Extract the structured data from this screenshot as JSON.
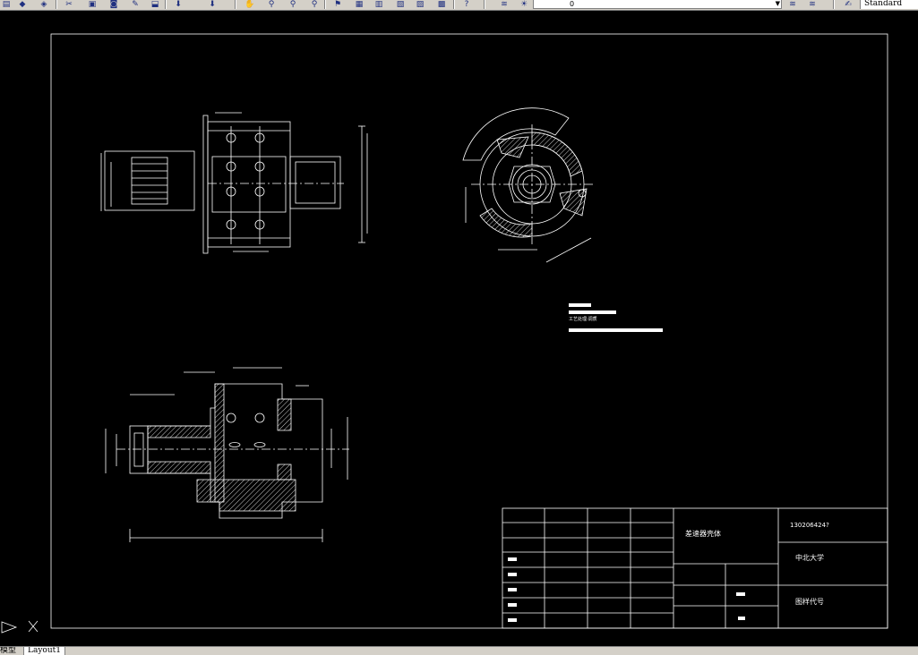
{
  "toolbar": {
    "layer_value": "0",
    "text_style": "Standard",
    "icons": [
      "open-icon",
      "save-icon",
      "print-icon",
      "cut-icon",
      "copy-icon",
      "paste-icon",
      "match-properties-icon",
      "undo-icon",
      "redo-icon",
      "pan-icon",
      "zoom-realtime-icon",
      "zoom-window-icon",
      "zoom-previous-icon",
      "properties-icon",
      "design-center-icon",
      "tool-palettes-icon",
      "sheet-set-icon",
      "markup-icon",
      "calculator-icon",
      "help-icon",
      "layer-manager-icon",
      "layer-state-icon",
      "layer-previous-icon",
      "text-style-icon"
    ]
  },
  "drawing": {
    "title_block": {
      "part_name": "差速器壳体",
      "drawing_number": "130206424?",
      "school": "中北大学",
      "sheet_label": "图样代号"
    },
    "notes": {
      "line_2": "工艺处理:调质"
    }
  },
  "layout_tabs": {
    "model_label": "模型",
    "layout_label": "Layout1"
  },
  "colors": {
    "background": "#000000",
    "line": "#ffffff",
    "toolbar": "#d4d0c8"
  }
}
